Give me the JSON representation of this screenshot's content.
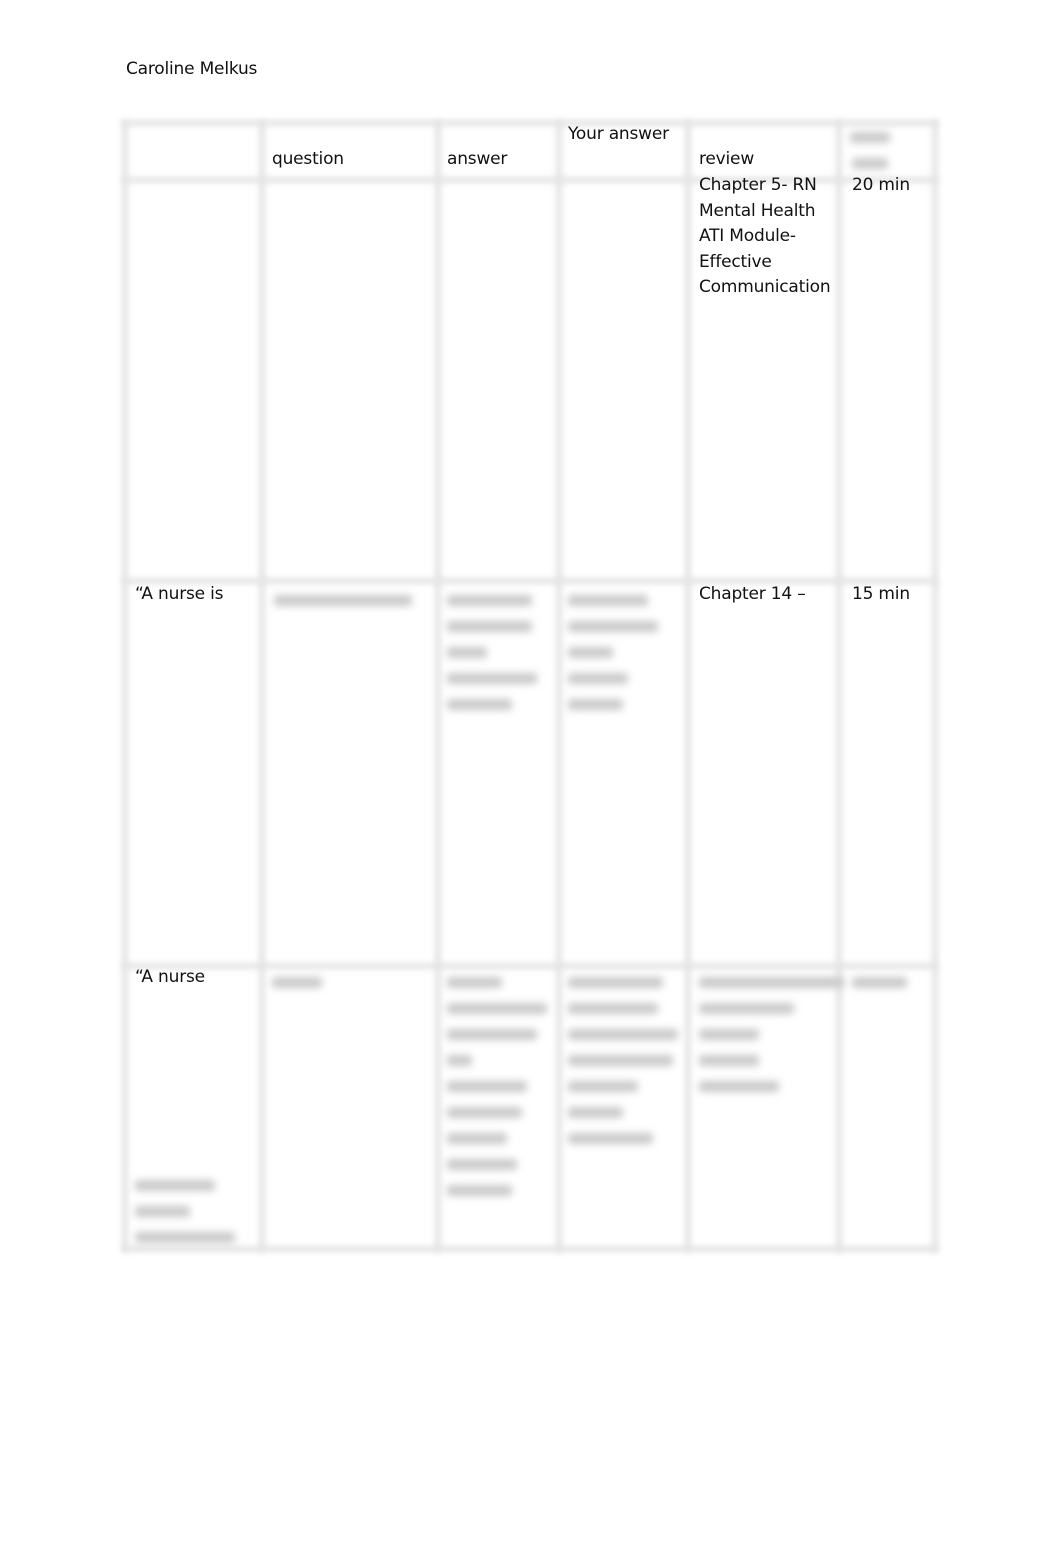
{
  "document": {
    "author": "Caroline Melkus",
    "table": {
      "headers": [
        "",
        "question",
        "answer",
        "Your answer",
        "review",
        ""
      ],
      "header_blurred_last_column": true,
      "rows": [
        {
          "col1": "",
          "col2": "",
          "col3": "",
          "col4": "",
          "review_lines": [
            "Chapter 5- RN",
            "Mental Health",
            "ATI Module-",
            "Effective",
            "Communication"
          ],
          "time": "20 min"
        },
        {
          "col1": "“A nurse is",
          "col2_blurred": true,
          "col3_blurred": true,
          "col4_blurred": true,
          "review_lines": [
            "Chapter 14 –"
          ],
          "time": "15 min"
        },
        {
          "col1": "“A nurse",
          "col1_trailing_blurred": true,
          "col2_blurred": true,
          "col3_blurred": true,
          "col4_blurred": true,
          "review_blurred": true,
          "time_blurred": true
        }
      ]
    }
  }
}
